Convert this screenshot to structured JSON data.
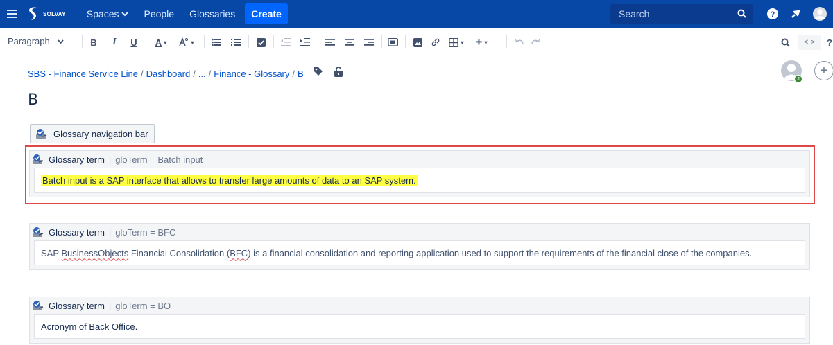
{
  "topnav": {
    "logo_text": "SOLVAY",
    "spaces": "Spaces",
    "people": "People",
    "glossaries": "Glossaries",
    "create": "Create",
    "search_placeholder": "Search"
  },
  "toolbar": {
    "paragraph": "Paragraph",
    "bold": "B",
    "italic": "I",
    "underline": "U",
    "text_color": "A"
  },
  "breadcrumb": {
    "items": [
      "SBS - Finance Service Line",
      "Dashboard",
      "...",
      "Finance - Glossary",
      "B"
    ],
    "separator": "/"
  },
  "avatar_badge": "J",
  "page_title": "B",
  "navbar_macro": "Glossary navigation bar",
  "terms": [
    {
      "label": "Glossary term",
      "param": "gloTerm = Batch input",
      "body": "Batch input is a SAP interface that allows to transfer large amounts of data to an SAP system."
    },
    {
      "label": "Glossary term",
      "param": "gloTerm = BFC",
      "body_parts": [
        "SAP ",
        "BusinessObjects",
        " Financial Consolidation (",
        "BFC",
        ") is a financial consolidation and reporting application used to support the requirements of the financial close of the companies."
      ]
    },
    {
      "label": "Glossary term",
      "param": "gloTerm = BO",
      "body": "Acronym of Back Office."
    }
  ],
  "colors": {
    "nav_bg": "#0747a6",
    "create_bg": "#0065ff",
    "highlight": "#ffff44",
    "outline": "#e04848"
  }
}
